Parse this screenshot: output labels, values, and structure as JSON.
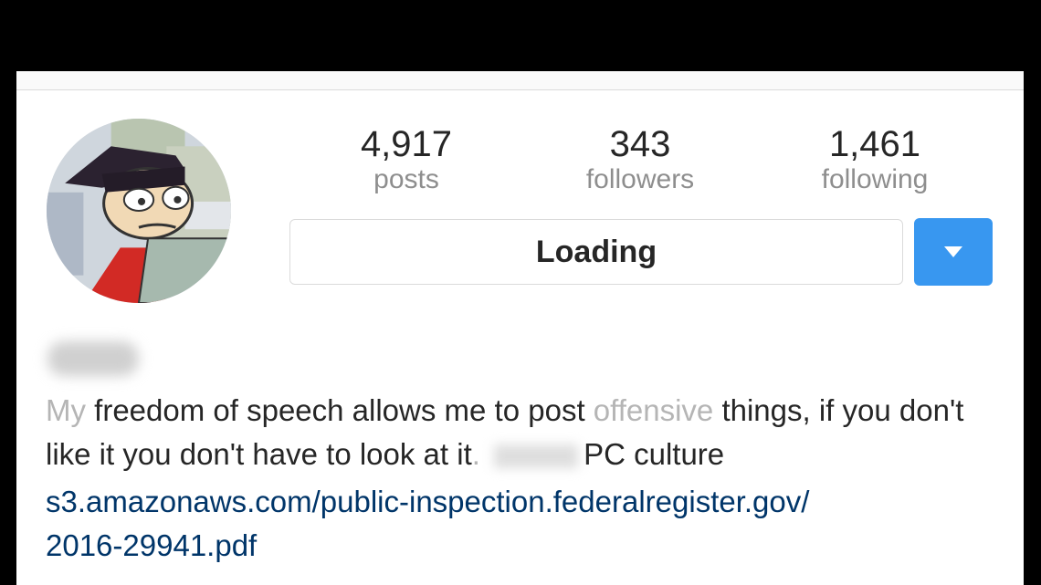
{
  "profile": {
    "stats": {
      "posts": {
        "count": "4,917",
        "label": "posts"
      },
      "followers": {
        "count": "343",
        "label": "followers"
      },
      "following": {
        "count": "1,461",
        "label": "following"
      }
    },
    "follow_button_label": "Loading",
    "bio": {
      "part1": "My ",
      "part2": "freedom of speech allows me to post ",
      "part3": "offensive",
      "part4": " things, if you don't like it you don't have to look at it",
      "part5": ". ",
      "part6": "PC culture"
    },
    "link": {
      "line1": "s3.amazonaws.com/public-inspection.federalregister.gov/",
      "line2": "2016-29941.pdf"
    }
  },
  "colors": {
    "accent": "#3897f0",
    "link": "#003569",
    "text": "#262626",
    "muted": "#8e8e8e"
  }
}
